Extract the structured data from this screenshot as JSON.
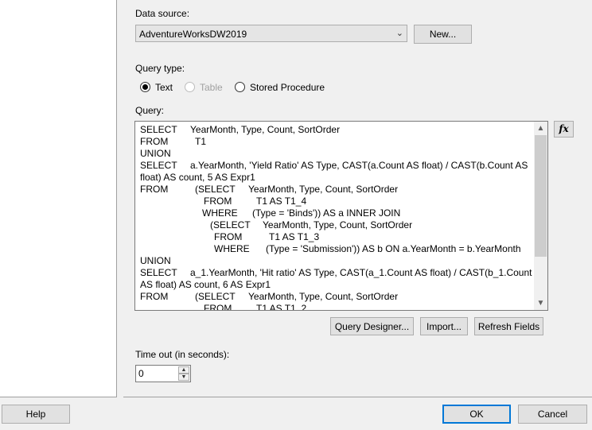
{
  "data_source": {
    "label": "Data source:",
    "selected": "AdventureWorksDW2019",
    "new_button": "New..."
  },
  "query_type": {
    "label": "Query type:",
    "options": [
      "Text",
      "Table",
      "Stored Procedure"
    ],
    "selected": "Text"
  },
  "query": {
    "label": "Query:",
    "lines": [
      [
        "SELECT",
        "YearMonth, Type, Count, SortOrder"
      ],
      [
        "FROM",
        "T1"
      ],
      [
        "UNION",
        ""
      ],
      [
        "SELECT",
        "a.YearMonth, 'Yield Ratio' AS Type, CAST(a.Count AS float) / CAST(b.Count AS"
      ],
      [
        "float) AS count, 5 AS Expr1",
        ""
      ],
      [
        "FROM",
        "(SELECT",
        "YearMonth, Type, Count, SortOrder"
      ],
      [
        "",
        "FROM",
        "T1 AS T1_4"
      ],
      [
        "",
        "WHERE",
        "(Type = 'Binds')) AS a INNER JOIN"
      ],
      [
        "",
        "(SELECT",
        "YearMonth, Type, Count, SortOrder"
      ],
      [
        "",
        "FROM",
        "T1 AS T1_3"
      ],
      [
        "",
        "WHERE",
        "(Type = 'Submission')) AS b ON a.YearMonth = b.YearMonth"
      ],
      [
        "UNION",
        ""
      ],
      [
        "SELECT",
        "a_1.YearMonth, 'Hit ratio' AS Type, CAST(a_1.Count AS float) / CAST(b_1.Count"
      ],
      [
        "AS float) AS count, 6 AS Expr1",
        ""
      ],
      [
        "FROM",
        "(SELECT",
        "YearMonth, Type, Count, SortOrder"
      ],
      [
        "",
        "FROM",
        "T1 AS T1_2"
      ]
    ],
    "expression_icon": "fx-icon"
  },
  "query_buttons": {
    "designer": "Query Designer...",
    "import": "Import...",
    "refresh": "Refresh Fields"
  },
  "timeout": {
    "label": "Time out (in seconds):",
    "value": "0"
  },
  "footer": {
    "help": "Help",
    "ok": "OK",
    "cancel": "Cancel"
  },
  "colors": {
    "accent": "#0078d7",
    "background": "#f0f0f0"
  }
}
